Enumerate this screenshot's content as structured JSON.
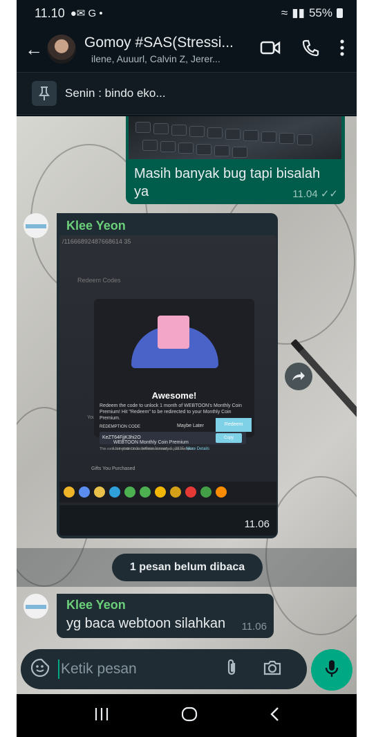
{
  "status": {
    "time": "11.10",
    "icons_left": [
      "m-icon",
      "gmail-icon",
      "google-icon",
      "dot"
    ],
    "battery": "55%"
  },
  "header": {
    "title": "Gomoy #SAS(Stressi...",
    "members": "ilene, Auuurl, Calvin Z, Jerer..."
  },
  "pinned": {
    "text": "Senin : bindo eko..."
  },
  "messages": {
    "outgoing": {
      "text": "Masih banyak bug tapi bisalah ya",
      "time": "11.04"
    },
    "image_msg": {
      "sender": "Klee Yeon",
      "time": "11.06",
      "screenshot": {
        "url_text": "/11666892487668614 35",
        "dialog_title": "Awesome!",
        "dialog_text": "Redeem the code to unlock 1 month of WEBTOON's Monthly Coin Premium! Hit \"Redeem\" to be redirected to your Monthly Coin Premium.",
        "code_label": "REDEMPTION CODE",
        "code": "KeZT64FjjK3hi2O",
        "copy": "Copy",
        "note": "This code is included in a confirmation email we just sent you.",
        "maybe_later": "Maybe Later",
        "redeem": "Redeem",
        "product": "WEBTOON Monthly Coin Premium",
        "product_sub": "Use your code before January 1, 2025.",
        "more": "More Details",
        "gifts": "Gifts You Purchased",
        "left_label": "Your",
        "page_title": "Redeem Codes"
      }
    },
    "unread_banner": "1 pesan belum dibaca",
    "last": {
      "sender": "Klee Yeon",
      "text": "yg baca webtoon silahkan",
      "time": "11.06"
    }
  },
  "composer": {
    "placeholder": "Ketik pesan"
  },
  "colors": {
    "accent": "#00a884",
    "sender": "#6bd07a",
    "outgoing": "#005c4b",
    "incoming": "#202c33"
  }
}
